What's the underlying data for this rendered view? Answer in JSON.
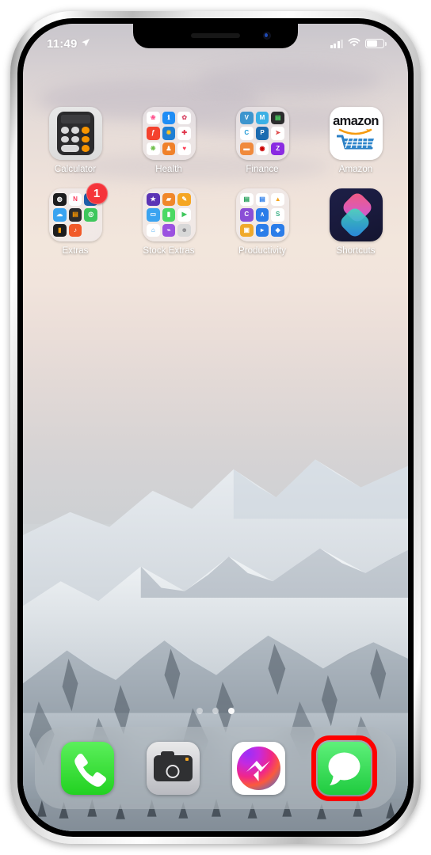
{
  "device": {
    "name": "iphone-x",
    "frame_color": "#e8e8e8"
  },
  "status_bar": {
    "time": "11:49",
    "location_icon": "location-arrow-icon",
    "cellular_icon": "signal-bars-icon",
    "wifi_icon": "wifi-icon",
    "battery_icon": "battery-icon",
    "battery_level_pct": 58
  },
  "home_screen": {
    "rows": [
      {
        "apps": [
          {
            "label": "Calculator",
            "type": "app",
            "icon": "calculator-icon",
            "badge": null
          },
          {
            "label": "Health",
            "type": "folder",
            "icon": "folder-icon",
            "badge": null,
            "mini_icons": [
              {
                "name": "carrot-icon",
                "bg": "#ffffff",
                "fg": "#ff4f8b",
                "glyph": "❀"
              },
              {
                "name": "fitness-icon",
                "bg": "#1f8df5",
                "fg": "#ffffff",
                "glyph": "i"
              },
              {
                "name": "calm-icon",
                "bg": "#ffffff",
                "fg": "#d94b6a",
                "glyph": "✿"
              },
              {
                "name": "flo-icon",
                "bg": "#f4422e",
                "fg": "#ffffff",
                "glyph": "f"
              },
              {
                "name": "walmart-icon",
                "bg": "#1f7fd4",
                "fg": "#ffc220",
                "glyph": "✹"
              },
              {
                "name": "firstaid-icon",
                "bg": "#ffffff",
                "fg": "#e0344a",
                "glyph": "✚"
              },
              {
                "name": "photos-icon",
                "bg": "#ffffff",
                "fg": "#6fbf4a",
                "glyph": "❋"
              },
              {
                "name": "vitamins-icon",
                "bg": "#f0812a",
                "fg": "#ffffff",
                "glyph": "♟"
              },
              {
                "name": "health-icon",
                "bg": "#ffffff",
                "fg": "#fc3c55",
                "glyph": "♥"
              }
            ]
          },
          {
            "label": "Finance",
            "type": "folder",
            "icon": "folder-icon",
            "badge": null,
            "mini_icons": [
              {
                "name": "venmo-icon",
                "bg": "#3d95ce",
                "fg": "#ffffff",
                "glyph": "V"
              },
              {
                "name": "mint-icon",
                "bg": "#3bb0e5",
                "fg": "#ffffff",
                "glyph": "M"
              },
              {
                "name": "wallet-icon",
                "bg": "#2c2c2e",
                "fg": "#4cd964",
                "glyph": "▤"
              },
              {
                "name": "creditkarma-icon",
                "bg": "#ffffff",
                "fg": "#1f9ad6",
                "glyph": "C"
              },
              {
                "name": "paypal-icon",
                "bg": "#1b6bb0",
                "fg": "#ffffff",
                "glyph": "P"
              },
              {
                "name": "acorns-icon",
                "bg": "#ffffff",
                "fg": "#e04a4a",
                "glyph": "➤"
              },
              {
                "name": "bank-icon",
                "bg": "#f08a3c",
                "fg": "#ffffff",
                "glyph": "▬"
              },
              {
                "name": "target-icon",
                "bg": "#ffffff",
                "fg": "#cc0000",
                "glyph": "◉"
              },
              {
                "name": "zelle-icon",
                "bg": "#8a2be2",
                "fg": "#ffffff",
                "glyph": "Z"
              }
            ]
          },
          {
            "label": "Amazon",
            "type": "app",
            "icon": "amazon-icon",
            "badge": null,
            "wordmark": "amazon"
          }
        ]
      },
      {
        "apps": [
          {
            "label": "Extras",
            "type": "folder",
            "icon": "folder-icon",
            "badge": "1",
            "mini_icons": [
              {
                "name": "watch-icon",
                "bg": "#1c1c1e",
                "fg": "#ffffff",
                "glyph": "◍"
              },
              {
                "name": "news-icon",
                "bg": "#ffffff",
                "fg": "#fb3b5c",
                "glyph": "N"
              },
              {
                "name": "nyt-icon",
                "bg": "#1f5faa",
                "fg": "#ffffff",
                "glyph": "≡"
              },
              {
                "name": "weather-icon",
                "bg": "#3aa3f0",
                "fg": "#ffffff",
                "glyph": "☁"
              },
              {
                "name": "calculator-mini-icon",
                "bg": "#2b2b2d",
                "fg": "#f79400",
                "glyph": "▤"
              },
              {
                "name": "findmy-icon",
                "bg": "#3ec75c",
                "fg": "#ffffff",
                "glyph": "◎"
              },
              {
                "name": "ibooks-icon",
                "bg": "#1c1c1e",
                "fg": "#ff9f0a",
                "glyph": "▮"
              },
              {
                "name": "garageband-icon",
                "bg": "#f15a29",
                "fg": "#ffffff",
                "glyph": "♪"
              },
              {
                "name": "empty-slot",
                "bg": "transparent",
                "fg": "#ffffff",
                "glyph": ""
              }
            ]
          },
          {
            "label": "Stock Extras",
            "type": "folder",
            "icon": "folder-icon",
            "badge": null,
            "mini_icons": [
              {
                "name": "imovie-icon",
                "bg": "#5b34b5",
                "fg": "#ffffff",
                "glyph": "★"
              },
              {
                "name": "itunesu-icon",
                "bg": "#f0872a",
                "fg": "#ffffff",
                "glyph": "🎓"
              },
              {
                "name": "pages-icon",
                "bg": "#f5a623",
                "fg": "#ffffff",
                "glyph": "✎"
              },
              {
                "name": "keynote-icon",
                "bg": "#3aa3f0",
                "fg": "#ffffff",
                "glyph": "▭"
              },
              {
                "name": "numbers-icon",
                "bg": "#4cd964",
                "fg": "#ffffff",
                "glyph": "▮"
              },
              {
                "name": "facetime-icon",
                "bg": "#ffffff",
                "fg": "#3ec75c",
                "glyph": "▶"
              },
              {
                "name": "home-icon",
                "bg": "#ffffff",
                "fg": "#f5a623",
                "glyph": "⌂"
              },
              {
                "name": "podcasts-icon",
                "bg": "#9b51e0",
                "fg": "#ffffff",
                "glyph": "((•))"
              },
              {
                "name": "contacts-icon",
                "bg": "#d8d8d8",
                "fg": "#8a8a8e",
                "glyph": "☻"
              }
            ]
          },
          {
            "label": "Productivity",
            "type": "folder",
            "icon": "folder-icon",
            "badge": null,
            "mini_icons": [
              {
                "name": "sheets-icon",
                "bg": "#ffffff",
                "fg": "#1f9d55",
                "glyph": "▤"
              },
              {
                "name": "docs-icon",
                "bg": "#ffffff",
                "fg": "#2b7de9",
                "glyph": "▤"
              },
              {
                "name": "drive-icon",
                "bg": "#ffffff",
                "fg": "#f5a623",
                "glyph": "▲"
              },
              {
                "name": "canvas-icon",
                "bg": "#8a4fd6",
                "fg": "#ffffff",
                "glyph": "C"
              },
              {
                "name": "notability-icon",
                "bg": "#2b7de9",
                "fg": "#ffffff",
                "glyph": "∧"
              },
              {
                "name": "slack-icon",
                "bg": "#ffffff",
                "fg": "#3aaf85",
                "glyph": "S"
              },
              {
                "name": "scanner-icon",
                "bg": "#f0a92a",
                "fg": "#ffffff",
                "glyph": "▣"
              },
              {
                "name": "zoom-icon",
                "bg": "#2b7de9",
                "fg": "#ffffff",
                "glyph": "▸"
              },
              {
                "name": "dropbox-icon",
                "bg": "#2b7de9",
                "fg": "#ffffff",
                "glyph": "◈"
              }
            ]
          },
          {
            "label": "Shortcuts",
            "type": "app",
            "icon": "shortcuts-icon",
            "badge": null
          }
        ]
      }
    ],
    "page_dots": {
      "count": 3,
      "active_index": 2
    }
  },
  "dock": {
    "apps": [
      {
        "label": "Phone",
        "icon": "phone-icon",
        "highlighted": false
      },
      {
        "label": "Camera",
        "icon": "camera-icon",
        "highlighted": false
      },
      {
        "label": "Messenger",
        "icon": "messenger-icon",
        "highlighted": false
      },
      {
        "label": "Messages",
        "icon": "messages-icon",
        "highlighted": true
      }
    ]
  },
  "annotation": {
    "shape": "rectangle",
    "color": "#fe0000",
    "target": "messages-icon"
  }
}
